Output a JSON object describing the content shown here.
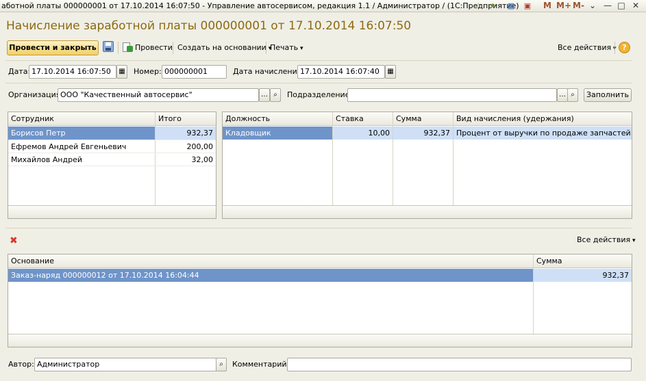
{
  "window": {
    "title": "аботной платы 000000001 от 17.10.2014 16:07:50 - Управление автосервисом, редакция 1.1 / Администратор /   (1С:Предприятие)",
    "buttons": {
      "m": "M",
      "m_plus": "M+",
      "m_minus": "M-"
    }
  },
  "heading": "Начисление заработной платы 000000001 от 17.10.2014 16:07:50",
  "toolbar": {
    "post_close": "Провести и закрыть",
    "post": "Провести",
    "create_basis": "Создать на основании",
    "print": "Печать",
    "all_actions": "Все действия"
  },
  "fields": {
    "date_label": "Дата:",
    "date_value": "17.10.2014 16:07:50",
    "number_label": "Номер:",
    "number_value": "000000001",
    "accrual_date_label": "Дата начисления:",
    "accrual_date_value": "17.10.2014 16:07:40",
    "org_label": "Организация:",
    "org_value": "ООО \"Качественный автосервис\"",
    "dept_label": "Подразделение:",
    "dept_value": "",
    "fill_button": "Заполнить",
    "author_label": "Автор:",
    "author_value": "Администратор",
    "comment_label": "Комментарий:",
    "comment_value": ""
  },
  "employees": {
    "headers": [
      "Сотрудник",
      "Итого"
    ],
    "rows": [
      [
        "Борисов Петр",
        "932,37"
      ],
      [
        "Ефремов Андрей Евгеньевич",
        "200,00"
      ],
      [
        "Михайлов Андрей",
        "32,00"
      ]
    ]
  },
  "accruals": {
    "headers": [
      "Должность",
      "Ставка",
      "Сумма",
      "Вид начисления (удержания)"
    ],
    "rows": [
      [
        "Кладовщик",
        "10,00",
        "932,37",
        "Процент от выручки по продаже запчастей"
      ]
    ]
  },
  "basis": {
    "all_actions": "Все действия",
    "headers": [
      "Основание",
      "Сумма"
    ],
    "rows": [
      [
        "Заказ-наряд 000000012 от 17.10.2014 16:04:44",
        "932,37"
      ]
    ]
  },
  "colors": {
    "heading": "#8c6a12",
    "selection": "#6f94c9",
    "selection_light": "#cfe0f6"
  }
}
